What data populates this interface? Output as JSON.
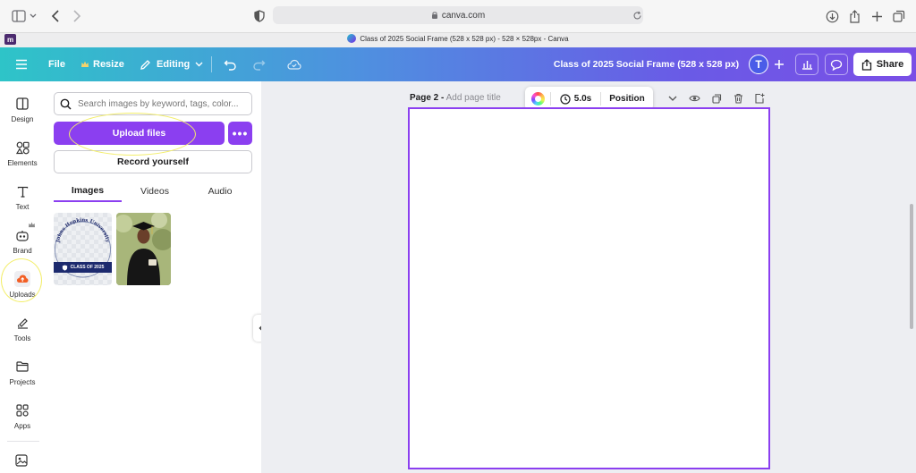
{
  "browser": {
    "url": "canva.com",
    "tab_title": "Class of 2025 Social Frame (528 x 528 px) - 528 × 528px - Canva",
    "tab_favicon": "m"
  },
  "toolbar": {
    "file_label": "File",
    "resize_label": "Resize",
    "editing_label": "Editing",
    "doc_title": "Class of 2025 Social Frame (528 x 528 px)",
    "avatar_initial": "T",
    "share_label": "Share"
  },
  "leftnav": {
    "items": [
      {
        "label": "Design",
        "icon": "design-icon"
      },
      {
        "label": "Elements",
        "icon": "elements-icon"
      },
      {
        "label": "Text",
        "icon": "text-icon"
      },
      {
        "label": "Brand",
        "icon": "brand-icon"
      },
      {
        "label": "Uploads",
        "icon": "uploads-icon"
      },
      {
        "label": "Tools",
        "icon": "tools-icon"
      },
      {
        "label": "Projects",
        "icon": "projects-icon"
      },
      {
        "label": "Apps",
        "icon": "apps-icon"
      }
    ]
  },
  "panel": {
    "search_placeholder": "Search images by keyword, tags, color...",
    "upload_label": "Upload files",
    "more_label": "•••",
    "record_label": "Record yourself",
    "tabs": [
      {
        "label": "Images",
        "active": true
      },
      {
        "label": "Videos",
        "active": false
      },
      {
        "label": "Audio",
        "active": false
      }
    ],
    "thumb1_text": "Johns Hopkins University",
    "thumb1_badge": "CLASS OF 2025"
  },
  "canvas": {
    "page_label": "Page 2 -",
    "page_title_placeholder": "Add page title",
    "duration": "5.0s",
    "position_label": "Position"
  },
  "colors": {
    "accent": "#8b3ff0",
    "highlight": "#f3ee6a"
  }
}
